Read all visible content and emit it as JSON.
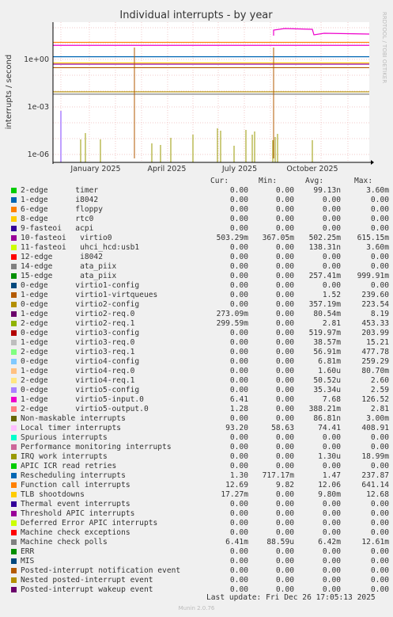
{
  "chart_data": {
    "type": "line",
    "title": "Individual interrupts - by year",
    "ylabel": "interrupts / second",
    "y_scale": "log",
    "y_ticks": [
      "1e+00",
      "1e-03",
      "1e-06"
    ],
    "x_ticks": [
      "January 2025",
      "April 2025",
      "July 2025",
      "October 2025"
    ],
    "side_label": "RRDTOOL / TOBI OETIKER",
    "series": [
      {
        "name": "2-edge      timer",
        "color": "#00cc00",
        "cur": "0.00",
        "min": "0.00",
        "avg": "99.13n",
        "max": "3.60m"
      },
      {
        "name": "1-edge      i8042",
        "color": "#0066b3",
        "cur": "0.00",
        "min": "0.00",
        "avg": "0.00",
        "max": "0.00"
      },
      {
        "name": "6-edge      floppy",
        "color": "#ff8000",
        "cur": "0.00",
        "min": "0.00",
        "avg": "0.00",
        "max": "0.00"
      },
      {
        "name": "8-edge      rtc0",
        "color": "#ffcc00",
        "cur": "0.00",
        "min": "0.00",
        "avg": "0.00",
        "max": "0.00"
      },
      {
        "name": "9-fasteoi   acpi",
        "color": "#330099",
        "cur": "0.00",
        "min": "0.00",
        "avg": "0.00",
        "max": "0.00"
      },
      {
        "name": "10-fasteoi   virtio0",
        "color": "#990099",
        "cur": "503.29m",
        "min": "367.05m",
        "avg": "502.25m",
        "max": "615.15m"
      },
      {
        "name": "11-fasteoi   uhci_hcd:usb1",
        "color": "#ccff00",
        "cur": "0.00",
        "min": "0.00",
        "avg": "138.31n",
        "max": "3.60m"
      },
      {
        "name": "12-edge      i8042",
        "color": "#ff0000",
        "cur": "0.00",
        "min": "0.00",
        "avg": "0.00",
        "max": "0.00"
      },
      {
        "name": "14-edge      ata_piix",
        "color": "#808080",
        "cur": "0.00",
        "min": "0.00",
        "avg": "0.00",
        "max": "0.00"
      },
      {
        "name": "15-edge      ata_piix",
        "color": "#008f00",
        "cur": "0.00",
        "min": "0.00",
        "avg": "257.41m",
        "max": "999.91m"
      },
      {
        "name": "0-edge      virtio1-config",
        "color": "#00487d",
        "cur": "0.00",
        "min": "0.00",
        "avg": "0.00",
        "max": "0.00"
      },
      {
        "name": "1-edge      virtio1-virtqueues",
        "color": "#b35a00",
        "cur": "0.00",
        "min": "0.00",
        "avg": "1.52",
        "max": "239.60"
      },
      {
        "name": "0-edge      virtio2-config",
        "color": "#b38f00",
        "cur": "0.00",
        "min": "0.00",
        "avg": "357.19m",
        "max": "223.54"
      },
      {
        "name": "1-edge      virtio2-req.0",
        "color": "#6b006b",
        "cur": "273.09m",
        "min": "0.00",
        "avg": "80.54m",
        "max": "8.19"
      },
      {
        "name": "2-edge      virtio2-req.1",
        "color": "#8fb300",
        "cur": "299.59m",
        "min": "0.00",
        "avg": "2.81",
        "max": "453.33"
      },
      {
        "name": "0-edge      virtio3-config",
        "color": "#b30000",
        "cur": "0.00",
        "min": "0.00",
        "avg": "519.97m",
        "max": "203.99"
      },
      {
        "name": "1-edge      virtio3-req.0",
        "color": "#bebebe",
        "cur": "0.00",
        "min": "0.00",
        "avg": "38.57m",
        "max": "15.21"
      },
      {
        "name": "2-edge      virtio3-req.1",
        "color": "#80ff80",
        "cur": "0.00",
        "min": "0.00",
        "avg": "56.91m",
        "max": "477.78"
      },
      {
        "name": "0-edge      virtio4-config",
        "color": "#80c9ff",
        "cur": "0.00",
        "min": "0.00",
        "avg": "6.81m",
        "max": "259.29"
      },
      {
        "name": "1-edge      virtio4-req.0",
        "color": "#ffc080",
        "cur": "0.00",
        "min": "0.00",
        "avg": "1.60u",
        "max": "80.70m"
      },
      {
        "name": "2-edge      virtio4-req.1",
        "color": "#ffe680",
        "cur": "0.00",
        "min": "0.00",
        "avg": "50.52u",
        "max": "2.60"
      },
      {
        "name": "0-edge      virtio5-config",
        "color": "#aa80ff",
        "cur": "0.00",
        "min": "0.00",
        "avg": "35.34u",
        "max": "2.59"
      },
      {
        "name": "1-edge      virtio5-input.0",
        "color": "#ee00cc",
        "cur": "6.41",
        "min": "0.00",
        "avg": "7.68",
        "max": "126.52"
      },
      {
        "name": "2-edge      virtio5-output.0",
        "color": "#ff8080",
        "cur": "1.28",
        "min": "0.00",
        "avg": "388.21m",
        "max": "2.81"
      },
      {
        "name": "Non-maskable interrupts",
        "color": "#666600",
        "cur": "0.00",
        "min": "0.00",
        "avg": "86.81n",
        "max": "3.00m"
      },
      {
        "name": "Local timer interrupts",
        "color": "#ffbfff",
        "cur": "93.20",
        "min": "58.63",
        "avg": "74.41",
        "max": "408.91"
      },
      {
        "name": "Spurious interrupts",
        "color": "#00ffcc",
        "cur": "0.00",
        "min": "0.00",
        "avg": "0.00",
        "max": "0.00"
      },
      {
        "name": "Performance monitoring interrupts",
        "color": "#cc6699",
        "cur": "0.00",
        "min": "0.00",
        "avg": "0.00",
        "max": "0.00"
      },
      {
        "name": "IRQ work interrupts",
        "color": "#999900",
        "cur": "0.00",
        "min": "0.00",
        "avg": "1.30u",
        "max": "18.99m"
      },
      {
        "name": "APIC ICR read retries",
        "color": "#00cc00",
        "cur": "0.00",
        "min": "0.00",
        "avg": "0.00",
        "max": "0.00"
      },
      {
        "name": "Rescheduling interrupts",
        "color": "#0066b3",
        "cur": "1.30",
        "min": "717.17m",
        "avg": "1.47",
        "max": "237.87"
      },
      {
        "name": "Function call interrupts",
        "color": "#ff8000",
        "cur": "12.69",
        "min": "9.82",
        "avg": "12.06",
        "max": "641.14"
      },
      {
        "name": "TLB shootdowns",
        "color": "#ffcc00",
        "cur": "17.27m",
        "min": "0.00",
        "avg": "9.80m",
        "max": "12.68"
      },
      {
        "name": "Thermal event interrupts",
        "color": "#330099",
        "cur": "0.00",
        "min": "0.00",
        "avg": "0.00",
        "max": "0.00"
      },
      {
        "name": "Threshold APIC interrupts",
        "color": "#990099",
        "cur": "0.00",
        "min": "0.00",
        "avg": "0.00",
        "max": "0.00"
      },
      {
        "name": "Deferred Error APIC interrupts",
        "color": "#ccff00",
        "cur": "0.00",
        "min": "0.00",
        "avg": "0.00",
        "max": "0.00"
      },
      {
        "name": "Machine check exceptions",
        "color": "#ff0000",
        "cur": "0.00",
        "min": "0.00",
        "avg": "0.00",
        "max": "0.00"
      },
      {
        "name": "Machine check polls",
        "color": "#808080",
        "cur": "6.41m",
        "min": "88.59u",
        "avg": "6.42m",
        "max": "12.61m"
      },
      {
        "name": "ERR",
        "color": "#008f00",
        "cur": "0.00",
        "min": "0.00",
        "avg": "0.00",
        "max": "0.00"
      },
      {
        "name": "MIS",
        "color": "#00487d",
        "cur": "0.00",
        "min": "0.00",
        "avg": "0.00",
        "max": "0.00"
      },
      {
        "name": "Posted-interrupt notification event",
        "color": "#b35a00",
        "cur": "0.00",
        "min": "0.00",
        "avg": "0.00",
        "max": "0.00"
      },
      {
        "name": "Nested posted-interrupt event",
        "color": "#b38f00",
        "cur": "0.00",
        "min": "0.00",
        "avg": "0.00",
        "max": "0.00"
      },
      {
        "name": "Posted-interrupt wakeup event",
        "color": "#6b006b",
        "cur": "0.00",
        "min": "0.00",
        "avg": "0.00",
        "max": "0.00"
      }
    ],
    "plotted_lines": [
      {
        "color": "#ff8000",
        "value": 12.0
      },
      {
        "color": "#ee00cc",
        "value": 7.7
      },
      {
        "color": "#0066b3",
        "value": 1.47
      },
      {
        "color": "#ffcc00",
        "value": 0.6
      },
      {
        "color": "#990099",
        "value": 0.5
      },
      {
        "color": "#b35a00",
        "value": 0.3
      },
      {
        "color": "#808080",
        "value": 0.0064
      },
      {
        "color": "#b38f00",
        "value": 0.009
      }
    ]
  },
  "legend_header": {
    "cur": "Cur:",
    "min": "Min:",
    "avg": "Avg:",
    "max": "Max:"
  },
  "footer": {
    "last_update": "Last update: Fri Dec 26 17:05:13 2025",
    "munin": "Munin 2.0.76"
  }
}
